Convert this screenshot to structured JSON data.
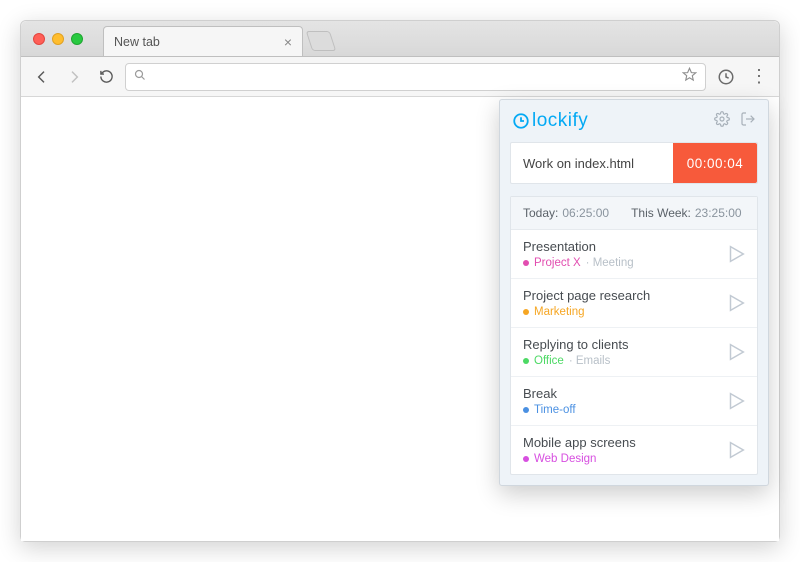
{
  "tabstrip": {
    "tab_title": "New tab"
  },
  "popup": {
    "brand": "lockify",
    "current": {
      "desc": "Work on index.html",
      "timer": "00:00:04"
    },
    "summary": {
      "today_label": "Today:",
      "today_value": "06:25:00",
      "week_label": "This Week:",
      "week_value": "23:25:00"
    },
    "items": [
      {
        "title": "Presentation",
        "bullet": "#e24db0",
        "project": "Project X",
        "project_color": "#e24db0",
        "extra": " · Meeting"
      },
      {
        "title": "Project page research",
        "bullet": "#f6a623",
        "project": "Marketing",
        "project_color": "#f6a623",
        "extra": ""
      },
      {
        "title": "Replying to clients",
        "bullet": "#4cd964",
        "project": "Office",
        "project_color": "#4cd964",
        "extra": " · Emails"
      },
      {
        "title": "Break",
        "bullet": "#4a90e2",
        "project": "Time-off",
        "project_color": "#4a90e2",
        "extra": ""
      },
      {
        "title": "Mobile app screens",
        "bullet": "#d74fe0",
        "project": "Web Design",
        "project_color": "#d74fe0",
        "extra": ""
      }
    ]
  }
}
